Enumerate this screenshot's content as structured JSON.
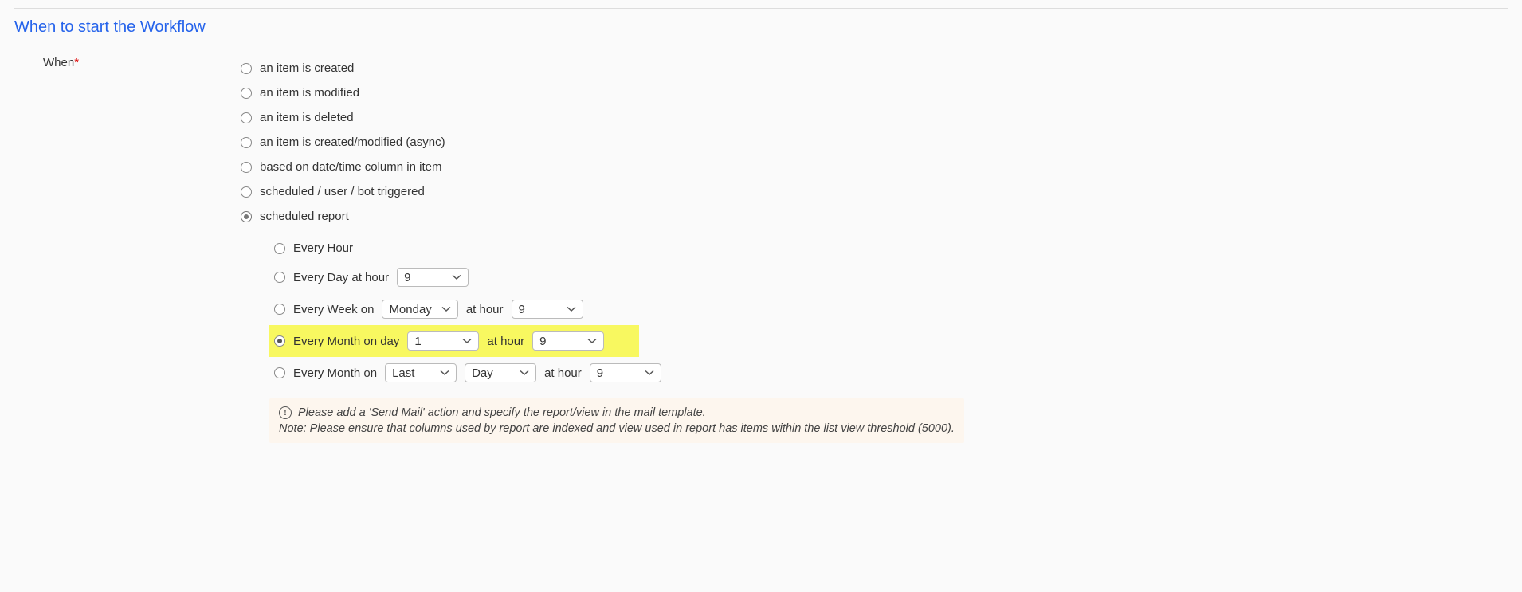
{
  "section": {
    "title": "When to start the Workflow"
  },
  "label": {
    "when": "When",
    "required": "*"
  },
  "options": {
    "created": "an item is created",
    "modified": "an item is modified",
    "deleted": "an item is deleted",
    "created_modified_async": "an item is created/modified (async)",
    "date_time_column": "based on date/time column in item",
    "scheduled_user_bot": "scheduled / user / bot triggered",
    "scheduled_report": "scheduled report"
  },
  "schedule": {
    "every_hour": "Every Hour",
    "every_day_prefix": "Every Day at hour",
    "every_week_prefix": "Every Week on",
    "every_week_mid": "at hour",
    "every_month_day_prefix": "Every Month on day",
    "every_month_day_mid": "at hour",
    "every_month_on_prefix": "Every Month on",
    "every_month_on_mid": "at hour"
  },
  "selects": {
    "day_hour": "9",
    "week_day": "Monday",
    "week_hour": "9",
    "month_day_num": "1",
    "month_day_hour": "9",
    "month_on_pos": "Last",
    "month_on_day": "Day",
    "month_on_hour": "9"
  },
  "notice": {
    "line1": "Please add a 'Send Mail' action and specify the report/view in the mail template.",
    "line2": "Note: Please ensure that columns used by report are indexed and view used in report has items within the list view threshold (5000)."
  }
}
